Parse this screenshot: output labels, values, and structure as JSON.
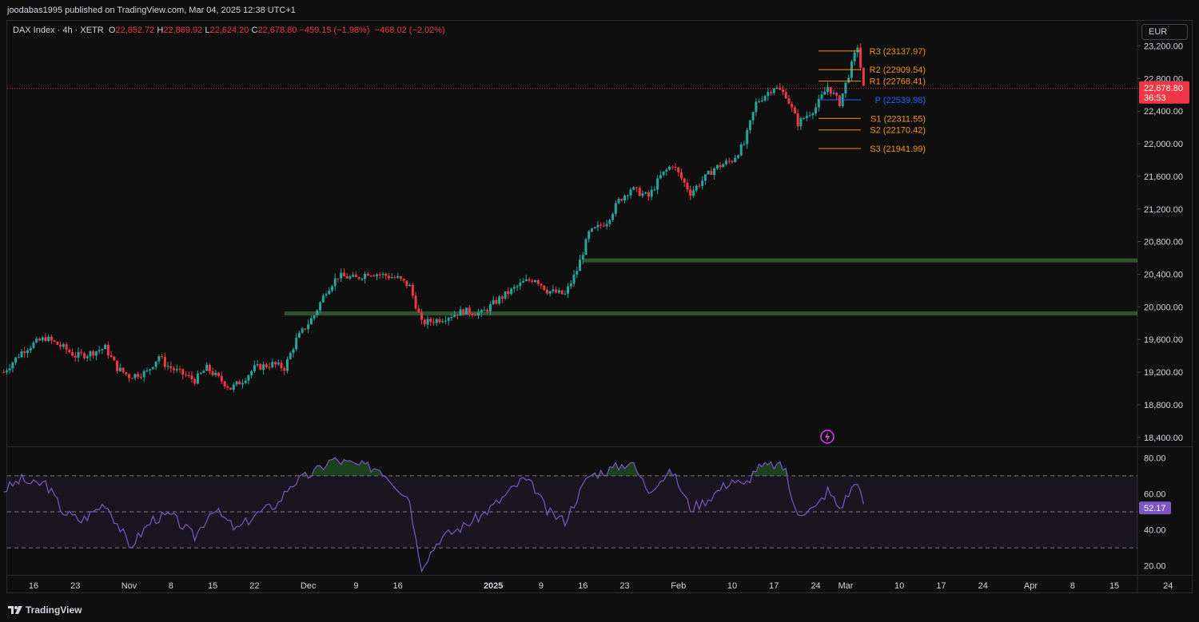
{
  "header": {
    "published_text": "joodabas1995 published on TradingView.com, Mar 04, 2025 12:38 UTC+1"
  },
  "legend": {
    "symbol": "DAX Index · 4h · XETR",
    "o_label": "O",
    "o_value": "22,852.72",
    "h_label": "H",
    "h_value": "22,869.92",
    "l_label": "L",
    "l_value": "22,624.20",
    "c_label": "C",
    "c_value": "22,678.80",
    "change": "−459.15 (−1.98%)",
    "change2": "−468.02 (−2.02%)"
  },
  "currency_button": "EUR",
  "footer": {
    "brand": "TradingView"
  },
  "colors": {
    "up": "#26a69a",
    "down": "#f23645",
    "pivot_orange": "#f7931a",
    "pivot_blue": "#2962ff",
    "rsi": "#7e57c2",
    "zone_green": "#4c8c4a",
    "price_tag": "#f23645",
    "rsi_tag": "#7e57c2"
  },
  "chart_data": [
    {
      "type": "candlestick",
      "title": "DAX Index · 4h · XETR",
      "ylim": [
        18300,
        23450
      ],
      "y_ticks": [
        "23,200.00",
        "22,800.00",
        "22,400.00",
        "22,000.00",
        "21,600.00",
        "21,200.00",
        "20,800.00",
        "20,400.00",
        "20,000.00",
        "19,600.00",
        "19,200.00",
        "18,800.00",
        "18,400.00"
      ],
      "x_ticks": [
        "16",
        "23",
        "Nov",
        "8",
        "15",
        "22",
        "Dec",
        "9",
        "16",
        "2025",
        "9",
        "16",
        "23",
        "Feb",
        "10",
        "17",
        "24",
        "Mar",
        "10",
        "17",
        "24",
        "Apr",
        "8",
        "15",
        "24"
      ],
      "last_price": "22,678.80",
      "countdown": "36:53",
      "anchor_points": [
        [
          "Oct 11",
          19200
        ],
        [
          "Oct 14",
          19450
        ],
        [
          "Oct 16",
          19550
        ],
        [
          "Oct 18",
          19620
        ],
        [
          "Oct 21",
          19500
        ],
        [
          "Oct 23",
          19400
        ],
        [
          "Oct 25",
          19420
        ],
        [
          "Oct 28",
          19500
        ],
        [
          "Oct 30",
          19250
        ],
        [
          "Nov 1",
          19150
        ],
        [
          "Nov 4",
          19200
        ],
        [
          "Nov 6",
          19400
        ],
        [
          "Nov 7",
          19300
        ],
        [
          "Nov 8",
          19250
        ],
        [
          "Nov 12",
          19100
        ],
        [
          "Nov 14",
          19250
        ],
        [
          "Nov 18",
          19000
        ],
        [
          "Nov 20",
          19100
        ],
        [
          "Nov 22",
          19250
        ],
        [
          "Nov 25",
          19300
        ],
        [
          "Nov 27",
          19250
        ],
        [
          "Nov 29",
          19600
        ],
        [
          "Dec 2",
          19900
        ],
        [
          "Dec 4",
          20200
        ],
        [
          "Dec 6",
          20380
        ],
        [
          "Dec 9",
          20350
        ],
        [
          "Dec 11",
          20420
        ],
        [
          "Dec 13",
          20400
        ],
        [
          "Dec 16",
          20350
        ],
        [
          "Dec 18",
          20250
        ],
        [
          "Dec 20",
          19800
        ],
        [
          "Dec 23",
          19850
        ],
        [
          "Dec 27",
          19950
        ],
        [
          "Dec 30",
          19920
        ],
        [
          "Jan 2",
          20100
        ],
        [
          "Jan 6",
          20300
        ],
        [
          "Jan 8",
          20350
        ],
        [
          "Jan 10",
          20200
        ],
        [
          "Jan 13",
          20150
        ],
        [
          "Jan 15",
          20450
        ],
        [
          "Jan 17",
          20900
        ],
        [
          "Jan 20",
          21050
        ],
        [
          "Jan 22",
          21300
        ],
        [
          "Jan 24",
          21450
        ],
        [
          "Jan 27",
          21350
        ],
        [
          "Jan 29",
          21600
        ],
        [
          "Jan 31",
          21750
        ],
        [
          "Feb 3",
          21400
        ],
        [
          "Feb 5",
          21550
        ],
        [
          "Feb 7",
          21700
        ],
        [
          "Feb 10",
          21800
        ],
        [
          "Feb 12",
          22000
        ],
        [
          "Feb 14",
          22500
        ],
        [
          "Feb 17",
          22700
        ],
        [
          "Feb 19",
          22600
        ],
        [
          "Feb 21",
          22250
        ],
        [
          "Feb 24",
          22450
        ],
        [
          "Feb 26",
          22700
        ],
        [
          "Feb 28",
          22500
        ],
        [
          "Mar 3",
          23200
        ],
        [
          "Mar 4",
          22678.8
        ]
      ]
    },
    {
      "type": "horizontal-levels",
      "levels": [
        {
          "label": "R3",
          "text": "R3 (23137.97)",
          "value": 23137.97,
          "color": "#f7931a"
        },
        {
          "label": "R2",
          "text": "R2 (22909.54)",
          "value": 22909.54,
          "color": "#f7931a"
        },
        {
          "label": "R1",
          "text": "R1 (22768.41)",
          "value": 22768.41,
          "color": "#f7931a"
        },
        {
          "label": "P",
          "text": "P (22539.98)",
          "value": 22539.98,
          "color": "#2962ff"
        },
        {
          "label": "S1",
          "text": "S1 (22311.55)",
          "value": 22311.55,
          "color": "#f7931a"
        },
        {
          "label": "S2",
          "text": "S2 (22170.42)",
          "value": 22170.42,
          "color": "#f7931a"
        },
        {
          "label": "S3",
          "text": "S3 (21941.99)",
          "value": 21941.99,
          "color": "#f7931a"
        }
      ],
      "zones": [
        {
          "value": 20570,
          "from": "Jan 16"
        },
        {
          "value": 19920,
          "from": "Nov 27"
        }
      ]
    },
    {
      "type": "line",
      "name": "RSI",
      "ylim": [
        15,
        85
      ],
      "y_ticks": [
        "80.00",
        "60.00",
        "40.00",
        "20.00"
      ],
      "bands": [
        70,
        50,
        30
      ],
      "last_value": "52.17",
      "anchor_points": [
        [
          "Oct 11",
          62
        ],
        [
          "Oct 14",
          68
        ],
        [
          "Oct 16",
          65
        ],
        [
          "Oct 18",
          66
        ],
        [
          "Oct 21",
          50
        ],
        [
          "Oct 24",
          45
        ],
        [
          "Oct 28",
          55
        ],
        [
          "Oct 31",
          38
        ],
        [
          "Nov 1",
          30
        ],
        [
          "Nov 5",
          46
        ],
        [
          "Nov 8",
          48
        ],
        [
          "Nov 12",
          36
        ],
        [
          "Nov 15",
          52
        ],
        [
          "Nov 19",
          40
        ],
        [
          "Nov 22",
          48
        ],
        [
          "Nov 26",
          55
        ],
        [
          "Nov 28",
          65
        ],
        [
          "Dec 2",
          72
        ],
        [
          "Dec 5",
          79
        ],
        [
          "Dec 9",
          76
        ],
        [
          "Dec 13",
          74
        ],
        [
          "Dec 16",
          64
        ],
        [
          "Dec 18",
          57
        ],
        [
          "Dec 19",
          35
        ],
        [
          "Dec 20",
          20
        ],
        [
          "Dec 23",
          35
        ],
        [
          "Dec 27",
          42
        ],
        [
          "Dec 30",
          48
        ],
        [
          "Jan 2",
          56
        ],
        [
          "Jan 6",
          68
        ],
        [
          "Jan 8",
          63
        ],
        [
          "Jan 10",
          50
        ],
        [
          "Jan 13",
          45
        ],
        [
          "Jan 15",
          58
        ],
        [
          "Jan 17",
          70
        ],
        [
          "Jan 21",
          74
        ],
        [
          "Jan 24",
          78
        ],
        [
          "Jan 27",
          62
        ],
        [
          "Jan 29",
          68
        ],
        [
          "Jan 31",
          72
        ],
        [
          "Feb 3",
          52
        ],
        [
          "Feb 5",
          55
        ],
        [
          "Feb 7",
          60
        ],
        [
          "Feb 10",
          68
        ],
        [
          "Feb 12",
          64
        ],
        [
          "Feb 14",
          74
        ],
        [
          "Feb 17",
          76
        ],
        [
          "Feb 19",
          74
        ],
        [
          "Feb 20",
          55
        ],
        [
          "Feb 21",
          50
        ],
        [
          "Feb 24",
          52
        ],
        [
          "Feb 26",
          62
        ],
        [
          "Feb 28",
          52
        ],
        [
          "Mar 3",
          68
        ],
        [
          "Mar 4",
          52.17
        ]
      ]
    }
  ]
}
